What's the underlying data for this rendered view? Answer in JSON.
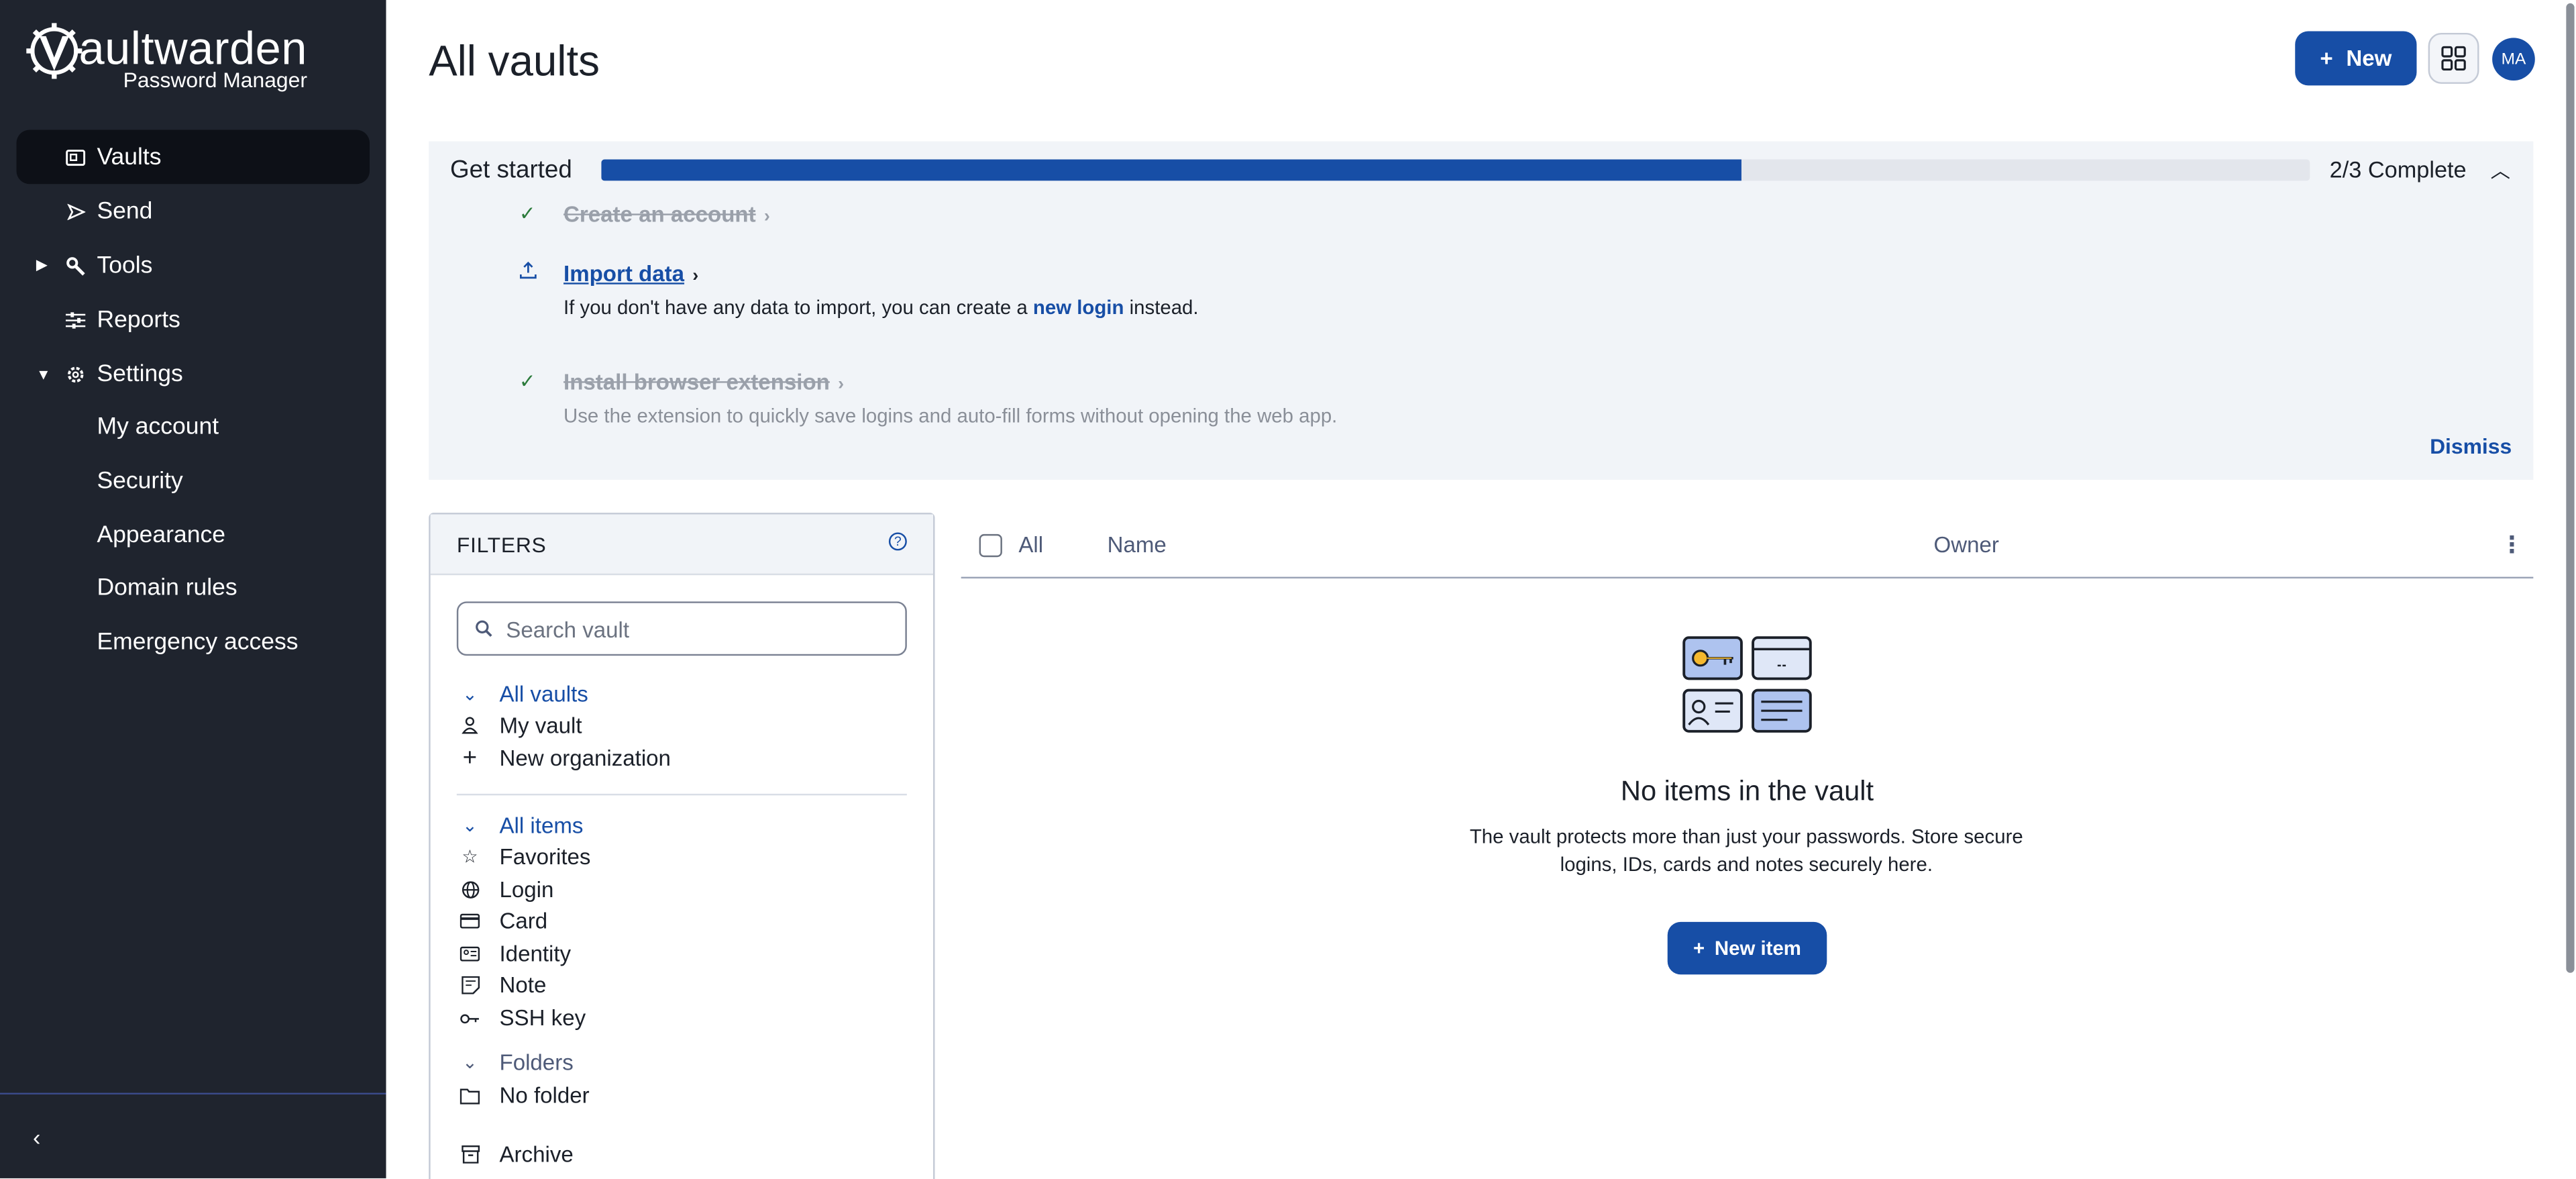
{
  "app": {
    "logo_main": "aultwarden",
    "logo_sub": "Password Manager"
  },
  "sidebar": {
    "items": [
      {
        "label": "Vaults",
        "icon": "vault-icon",
        "active": true
      },
      {
        "label": "Send",
        "icon": "send-icon"
      },
      {
        "label": "Tools",
        "icon": "wrench-icon",
        "caret": "collapsed"
      },
      {
        "label": "Reports",
        "icon": "sliders-icon"
      },
      {
        "label": "Settings",
        "icon": "gear-icon",
        "caret": "expanded"
      }
    ],
    "settings_subitems": [
      "My account",
      "Security",
      "Appearance",
      "Domain rules",
      "Emergency access"
    ]
  },
  "header": {
    "title": "All vaults",
    "new_label": "New",
    "avatar_initials": "MA"
  },
  "get_started": {
    "title": "Get started",
    "progress_fraction": 0.667,
    "complete_label": "2/3 Complete",
    "steps": [
      {
        "title": "Create an account",
        "done": true
      },
      {
        "title": "Import data",
        "done": false,
        "desc_before": "If you don't have any data to import, you can create a ",
        "desc_link": "new login",
        "desc_after": " instead."
      },
      {
        "title": "Install browser extension",
        "done": true,
        "desc": "Use the extension to quickly save logins and auto-fill forms without opening the web app."
      }
    ],
    "dismiss_label": "Dismiss"
  },
  "filters": {
    "title": "FILTERS",
    "search_placeholder": "Search vault",
    "vaults_header": "All vaults",
    "vaults": [
      "My vault",
      "New organization"
    ],
    "items_header": "All items",
    "types": [
      "Favorites",
      "Login",
      "Card",
      "Identity",
      "Note",
      "SSH key"
    ],
    "folders_header": "Folders",
    "folders": [
      "No folder"
    ],
    "archive_label": "Archive"
  },
  "list": {
    "col_all": "All",
    "col_name": "Name",
    "col_owner": "Owner"
  },
  "empty_state": {
    "title": "No items in the vault",
    "desc": "The vault protects more than just your passwords. Store secure logins, IDs, cards and notes securely here.",
    "button_label": "New item"
  },
  "colors": {
    "brand": "#174ea6",
    "sidebar_bg": "#1f242e",
    "panel_bg": "#f1f4f8"
  }
}
